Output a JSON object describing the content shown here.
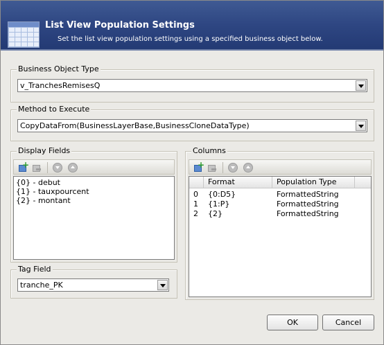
{
  "header": {
    "title": "List View Population Settings",
    "subtitle": "Set the list view population settings using a specified business object below.",
    "icon": "grid-table-icon"
  },
  "business_object": {
    "label": "Business Object Type",
    "value": "v_TranchesRemisesQ"
  },
  "method": {
    "label": "Method to Execute",
    "value": "CopyDataFrom(BusinessLayerBase,BusinessCloneDataType)"
  },
  "display_fields": {
    "label": "Display Fields",
    "items": [
      "{0} - debut",
      "{1} - tauxpourcent",
      "{2} - montant"
    ]
  },
  "tag_field": {
    "label": "Tag Field",
    "value": "tranche_PK"
  },
  "columns": {
    "label": "Columns",
    "headers": [
      "Format",
      "Population Type"
    ],
    "rows": [
      {
        "index": "0",
        "format": "{0:D5}",
        "type": "FormattedString"
      },
      {
        "index": "1",
        "format": "{1:P}",
        "type": "FormattedString"
      },
      {
        "index": "2",
        "format": "{2}",
        "type": "FormattedString"
      }
    ]
  },
  "buttons": {
    "ok": "OK",
    "cancel": "Cancel"
  }
}
